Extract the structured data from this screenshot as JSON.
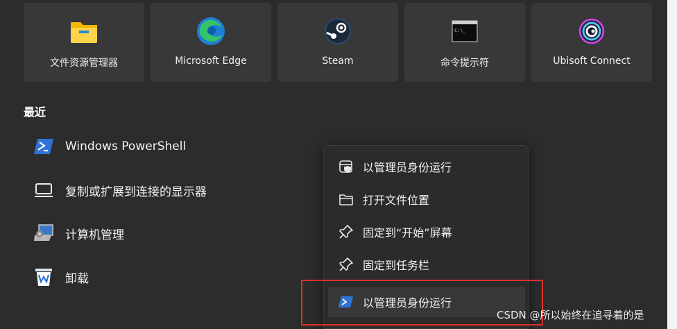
{
  "pinned": [
    {
      "label": "文件资源管理器",
      "icon": "folder-icon"
    },
    {
      "label": "Microsoft Edge",
      "icon": "edge-icon"
    },
    {
      "label": "Steam",
      "icon": "steam-icon"
    },
    {
      "label": "命令提示符",
      "icon": "cmd-icon"
    },
    {
      "label": "Ubisoft Connect",
      "icon": "ubisoft-icon"
    }
  ],
  "recent": {
    "title": "最近",
    "items": [
      {
        "label": "Windows PowerShell",
        "icon": "powershell-icon"
      },
      {
        "label": "复制或扩展到连接的显示器",
        "icon": "display-icon"
      },
      {
        "label": "计算机管理",
        "icon": "computer-management-icon"
      },
      {
        "label": "卸载",
        "icon": "wps-icon"
      }
    ]
  },
  "context_menu": {
    "items": [
      {
        "label": "以管理员身份运行",
        "icon": "shield-icon"
      },
      {
        "label": "打开文件位置",
        "icon": "folder-outline-icon"
      },
      {
        "label": "固定到“开始”屏幕",
        "icon": "pin-icon"
      },
      {
        "label": "固定到任务栏",
        "icon": "pin-icon"
      },
      {
        "label": "以管理员身份运行",
        "icon": "powershell-icon"
      }
    ]
  },
  "watermark": "CSDN @所以始终在追寻着的是",
  "colors": {
    "background": "#2c2c2c",
    "tile": "#383838",
    "highlight": "#d9322b"
  }
}
